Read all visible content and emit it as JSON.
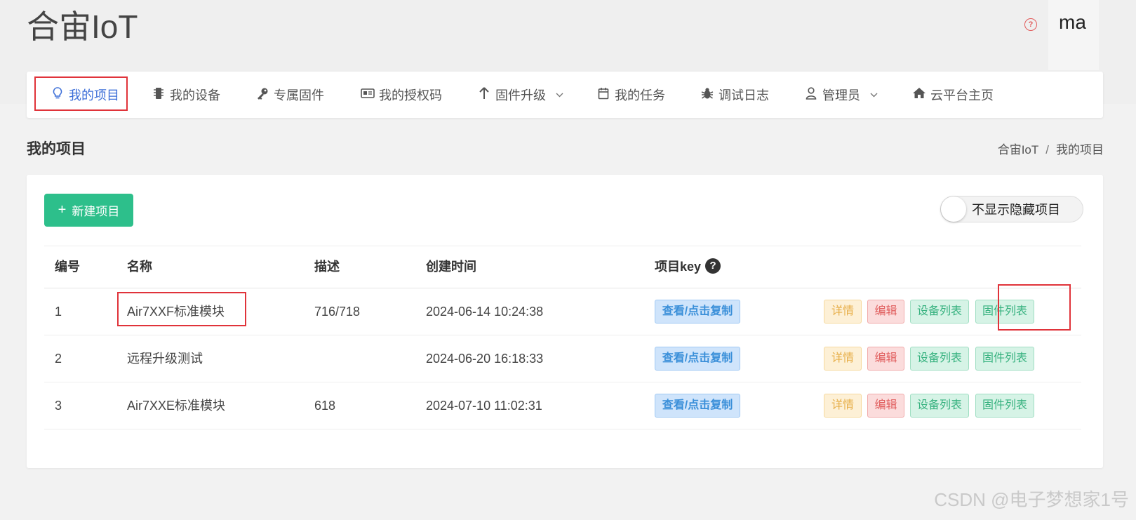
{
  "header": {
    "logo": "合宙IoT",
    "username": "ma"
  },
  "nav": {
    "items": [
      {
        "label": "我的项目",
        "icon": "lightbulb-icon",
        "active": true
      },
      {
        "label": "我的设备",
        "icon": "chip-icon"
      },
      {
        "label": "专属固件",
        "icon": "key-icon"
      },
      {
        "label": "我的授权码",
        "icon": "id-card-icon"
      },
      {
        "label": "固件升级",
        "icon": "arrow-up-icon",
        "dropdown": true
      },
      {
        "label": "我的任务",
        "icon": "calendar-icon"
      },
      {
        "label": "调试日志",
        "icon": "bug-icon"
      },
      {
        "label": "管理员",
        "icon": "user-icon",
        "dropdown": true
      },
      {
        "label": "云平台主页",
        "icon": "home-icon"
      }
    ]
  },
  "page": {
    "title": "我的项目",
    "breadcrumb": [
      "合宙IoT",
      "我的项目"
    ]
  },
  "toolbar": {
    "new_project_label": "新建项目",
    "toggle_label": "不显示隐藏项目"
  },
  "table": {
    "headers": {
      "id": "编号",
      "name": "名称",
      "desc": "描述",
      "created": "创建时间",
      "key": "项目key"
    },
    "rows": [
      {
        "id": "1",
        "name": "Air7XXF标准模块",
        "desc": "716/718",
        "created": "2024-06-14 10:24:38"
      },
      {
        "id": "2",
        "name": "远程升级测试",
        "desc": "",
        "created": "2024-06-20 16:18:33"
      },
      {
        "id": "3",
        "name": "Air7XXE标准模块",
        "desc": "618",
        "created": "2024-07-10 11:02:31"
      }
    ],
    "actions": {
      "view_key": "查看/点击复制",
      "detail": "详情",
      "edit": "编辑",
      "device_list": "设备列表",
      "firmware_list": "固件列表"
    }
  },
  "watermark": "CSDN @电子梦想家1号",
  "colors": {
    "primary_green": "#2dbf8b",
    "active_blue": "#3d6fd8",
    "highlight_red": "#e0333a"
  }
}
